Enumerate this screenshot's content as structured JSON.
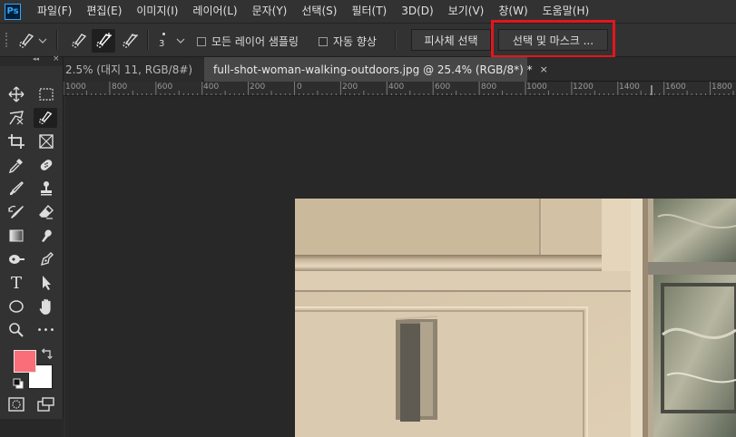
{
  "app": {
    "logo": "Ps"
  },
  "menu": [
    {
      "label": "파일(F)"
    },
    {
      "label": "편집(E)"
    },
    {
      "label": "이미지(I)"
    },
    {
      "label": "레이어(L)"
    },
    {
      "label": "문자(Y)"
    },
    {
      "label": "선택(S)"
    },
    {
      "label": "필터(T)"
    },
    {
      "label": "3D(D)"
    },
    {
      "label": "보기(V)"
    },
    {
      "label": "창(W)"
    },
    {
      "label": "도움말(H)"
    }
  ],
  "options": {
    "brush_size": "3",
    "sample_all_layers": {
      "label": "모든 레이어 샘플링",
      "checked": false
    },
    "auto_enhance": {
      "label": "자동 향상",
      "checked": false
    },
    "select_subject_label": "피사체 선택",
    "select_and_mask_label": "선택 및 마스크 ..."
  },
  "tabs": [
    {
      "label": "2.5% (대지 11, RGB/8#)",
      "active": false
    },
    {
      "label": "full-shot-woman-walking-outdoors.jpg @ 25.4% (RGB/8*) *",
      "active": true
    }
  ],
  "tab_close_glyph": "×",
  "ruler_labels": [
    "1000",
    "800",
    "600",
    "400",
    "200",
    "0",
    "200",
    "400",
    "600",
    "800",
    "1000",
    "1200",
    "1400",
    "1600",
    "1800"
  ],
  "toolbox": {
    "collapse_glyph": "◂◂",
    "close_glyph": "×"
  },
  "colors": {
    "foreground": "#f96e78",
    "background": "#ffffff",
    "highlight": "#e3161c"
  },
  "tools": [
    {
      "name": "move-tool-icon"
    },
    {
      "name": "marquee-tool-icon"
    },
    {
      "name": "lasso-tool-icon"
    },
    {
      "name": "quick-selection-tool-icon",
      "active": true
    },
    {
      "name": "crop-tool-icon"
    },
    {
      "name": "frame-tool-icon"
    },
    {
      "name": "eyedropper-tool-icon"
    },
    {
      "name": "healing-brush-tool-icon"
    },
    {
      "name": "brush-tool-icon"
    },
    {
      "name": "clone-stamp-tool-icon"
    },
    {
      "name": "history-brush-tool-icon"
    },
    {
      "name": "eraser-tool-icon"
    },
    {
      "name": "gradient-tool-icon"
    },
    {
      "name": "blur-tool-icon"
    },
    {
      "name": "dodge-tool-icon"
    },
    {
      "name": "pen-tool-icon"
    },
    {
      "name": "type-tool-icon"
    },
    {
      "name": "path-selection-tool-icon"
    },
    {
      "name": "ellipse-tool-icon"
    },
    {
      "name": "hand-tool-icon"
    },
    {
      "name": "zoom-tool-icon"
    },
    {
      "name": "more-tools-icon"
    },
    {
      "name": "quick-mask-icon"
    },
    {
      "name": "screen-mode-icon"
    }
  ],
  "type_tool_glyph": "T",
  "more_tools_glyph": "•••"
}
